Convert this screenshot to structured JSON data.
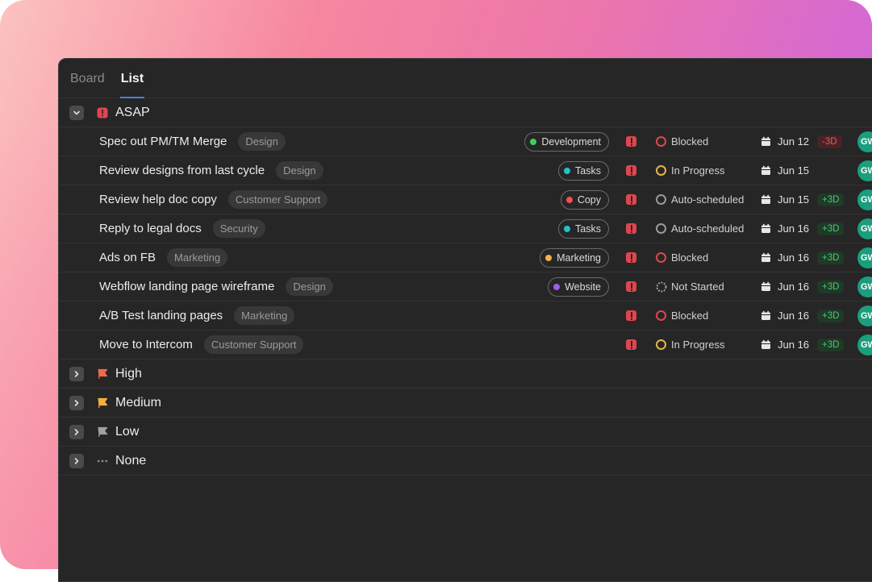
{
  "tabs": [
    {
      "label": "Board",
      "active": false
    },
    {
      "label": "List",
      "active": true
    }
  ],
  "colors": {
    "blocked": "#e0454f",
    "in_progress": "#e8b44a",
    "auto_scheduled": "#9a9a9a",
    "not_started": "#9a9a9a",
    "development": "#3fcf5c",
    "tasks": "#22c1c7",
    "copy": "#ef4f56",
    "marketing": "#f4b040",
    "website": "#9a62e6",
    "avatar": "#1a9e7e"
  },
  "groups": [
    {
      "name": "ASAP",
      "icon": "urgent-icon",
      "expanded": true
    },
    {
      "name": "High",
      "icon": "flag-red-icon",
      "expanded": false
    },
    {
      "name": "Medium",
      "icon": "flag-yellow-icon",
      "expanded": false
    },
    {
      "name": "Low",
      "icon": "flag-gray-icon",
      "expanded": false
    },
    {
      "name": "None",
      "icon": "dots-icon",
      "expanded": false
    }
  ],
  "tasks": [
    {
      "title": "Spec out PM/TM Merge",
      "label": "Design",
      "project": "Development",
      "project_color": "#3fcf5c",
      "status": "Blocked",
      "status_color": "#e0454f",
      "date": "Jun 12",
      "delta": "-3D",
      "delta_type": "neg",
      "assignee": "GW"
    },
    {
      "title": "Review designs from last cycle",
      "label": "Design",
      "project": "Tasks",
      "project_color": "#22c1c7",
      "status": "In Progress",
      "status_color": "#e8b44a",
      "date": "Jun 15",
      "delta": "",
      "delta_type": "",
      "assignee": "GW"
    },
    {
      "title": "Review help doc copy",
      "label": "Customer Support",
      "project": "Copy",
      "project_color": "#ef4f56",
      "status": "Auto-scheduled",
      "status_color": "#9a9a9a",
      "date": "Jun 15",
      "delta": "+3D",
      "delta_type": "pos",
      "assignee": "GW"
    },
    {
      "title": "Reply to legal docs",
      "label": "Security",
      "project": "Tasks",
      "project_color": "#22c1c7",
      "status": "Auto-scheduled",
      "status_color": "#9a9a9a",
      "date": "Jun 16",
      "delta": "+3D",
      "delta_type": "pos",
      "assignee": "GW"
    },
    {
      "title": "Ads on FB",
      "label": "Marketing",
      "project": "Marketing",
      "project_color": "#f4b040",
      "status": "Blocked",
      "status_color": "#e0454f",
      "date": "Jun 16",
      "delta": "+3D",
      "delta_type": "pos",
      "assignee": "GW"
    },
    {
      "title": "Webflow landing page wireframe",
      "label": "Design",
      "project": "Website",
      "project_color": "#9a62e6",
      "status": "Not Started",
      "status_color": "dashed",
      "date": "Jun 16",
      "delta": "+3D",
      "delta_type": "pos",
      "assignee": "GW"
    },
    {
      "title": "A/B Test landing pages",
      "label": "Marketing",
      "project": "",
      "project_color": "",
      "status": "Blocked",
      "status_color": "#e0454f",
      "date": "Jun 16",
      "delta": "+3D",
      "delta_type": "pos",
      "assignee": "GW"
    },
    {
      "title": "Move to Intercom",
      "label": "Customer Support",
      "project": "",
      "project_color": "",
      "status": "In Progress",
      "status_color": "#e8b44a",
      "date": "Jun 16",
      "delta": "+3D",
      "delta_type": "pos",
      "assignee": "GW"
    }
  ]
}
